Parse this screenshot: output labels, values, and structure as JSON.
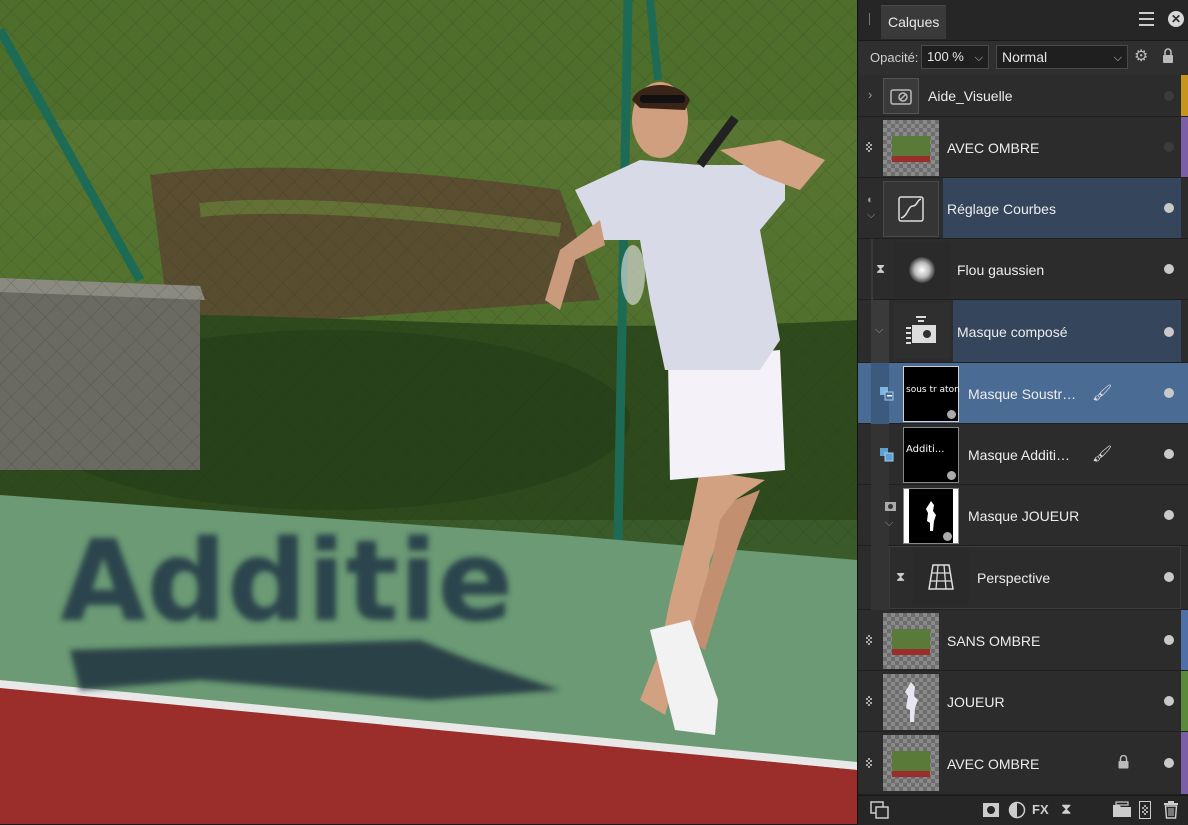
{
  "panel": {
    "tab_label": "Calques",
    "opacity_label": "Opacité:",
    "opacity_value": "100 %",
    "blend_mode": "Normal"
  },
  "layers": [
    {
      "name": "Aide_Visuelle",
      "type": "group",
      "color": "#c7951b"
    },
    {
      "name": "AVEC OMBRE",
      "type": "pixel",
      "color": "#7a5fa8"
    },
    {
      "name": "Réglage Courbes",
      "type": "curves-adjustment",
      "selected": true
    },
    {
      "name": "Flou gaussien",
      "type": "live-filter"
    },
    {
      "name": "Masque composé",
      "type": "compound-mask",
      "selected": true
    },
    {
      "name": "Masque Soustr…",
      "type": "mask",
      "highlighted": true
    },
    {
      "name": "Masque Additi…",
      "type": "mask"
    },
    {
      "name": "Masque JOUEUR",
      "type": "mask"
    },
    {
      "name": "Perspective",
      "type": "live-filter"
    },
    {
      "name": "SANS OMBRE",
      "type": "pixel",
      "color": "#4f6fa8"
    },
    {
      "name": "JOUEUR",
      "type": "pixel",
      "color": "#5b8a3a"
    },
    {
      "name": "AVEC OMBRE",
      "type": "pixel",
      "color": "#7a5fa8",
      "locked": true
    }
  ],
  "mask_thumbs": {
    "subtract_text": "sous tr aton",
    "add_text": "Additi..."
  },
  "canvas": {
    "painted_text": "Additie"
  },
  "icons": [
    "menu-icon",
    "close-icon",
    "gear-icon",
    "lock-icon",
    "eye-icon",
    "brush-icon",
    "mask-icon",
    "adjustment-icon",
    "fx-icon",
    "hourglass-icon",
    "group-icon",
    "delete-icon"
  ]
}
